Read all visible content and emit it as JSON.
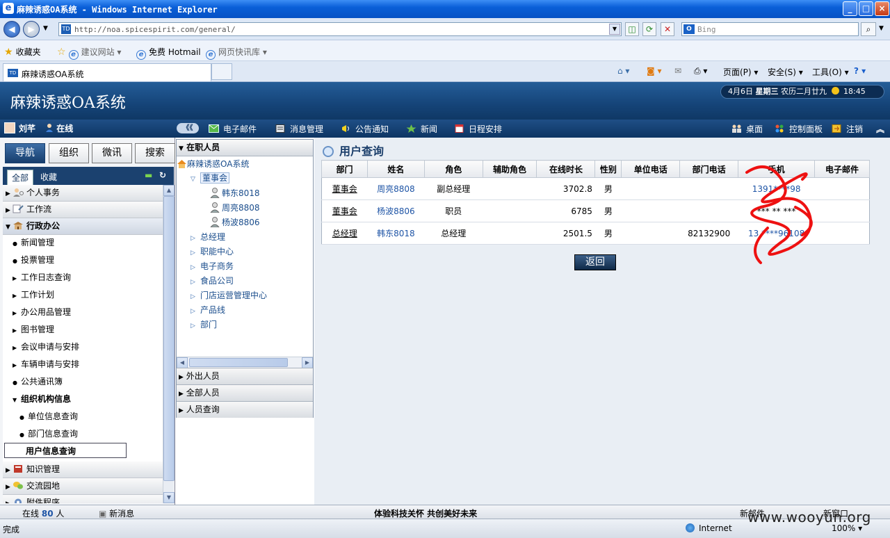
{
  "browser": {
    "window_title": "麻辣诱惑OA系统 - Windows Internet Explorer",
    "url": "http://noa.spicespirit.com/general/",
    "search_placeholder": "Bing",
    "favorites": {
      "favorites_label": "收藏夹",
      "suggested_sites": "建议网站",
      "free_hotmail": "免费 Hotmail",
      "web_slice": "网页快讯库"
    },
    "tab_title": "麻辣诱惑OA系统",
    "commands": {
      "page": "页面(P)",
      "safety": "安全(S)",
      "tools": "工具(O)"
    },
    "status_text": "完成",
    "zone": "Internet",
    "zoom": "100%"
  },
  "app": {
    "title": "麻辣诱惑OA系统",
    "date": "4月6日",
    "weekday": "星期三",
    "lunar": "农历二月廿九",
    "time": "18:45",
    "user": {
      "name": "刘芊",
      "status": "在线"
    },
    "top_nav": [
      "电子邮件",
      "消息管理",
      "公告通知",
      "新闻",
      "日程安排"
    ],
    "right_nav": {
      "desktop": "桌面",
      "control_panel": "控制面板",
      "logout": "注销"
    },
    "collapse_glyph": "《《"
  },
  "left_panel": {
    "tabs": [
      "导航",
      "组织",
      "微讯",
      "搜索"
    ],
    "subtabs": [
      "全部",
      "收藏"
    ],
    "menu": {
      "personal": "个人事务",
      "workflow": "工作流",
      "admin": "行政办公",
      "admin_items": [
        "新闻管理",
        "投票管理",
        "工作日志查询",
        "工作计划",
        "办公用品管理",
        "图书管理",
        "会议申请与安排",
        "车辆申请与安排",
        "公共通讯簿"
      ],
      "org_info": "组织机构信息",
      "org_items": [
        "单位信息查询",
        "部门信息查询"
      ],
      "selected_item": "用户信息查询",
      "knowledge": "知识管理",
      "exchange": "交流园地",
      "attach": "附件程序"
    }
  },
  "tree": {
    "header": "在职人员",
    "root": "麻辣诱惑OA系统",
    "nodes": {
      "board": "董事会",
      "board_members": [
        "韩东8018",
        "周亮8808",
        "杨波8806"
      ],
      "departments": [
        "总经理",
        "职能中心",
        "电子商务",
        "食品公司",
        "门店运营管理中心",
        "产品线",
        "部门"
      ]
    },
    "sections": [
      "外出人员",
      "全部人员",
      "人员查询"
    ]
  },
  "main": {
    "title": "用户查询",
    "columns": [
      "部门",
      "姓名",
      "角色",
      "辅助角色",
      "在线时长",
      "性别",
      "单位电话",
      "部门电话",
      "手机",
      "电子邮件"
    ],
    "rows": [
      {
        "dept": "董事会",
        "name": "周亮8808",
        "role": "副总经理",
        "aux": "",
        "online": "3702.8",
        "gender": "男",
        "unit_phone": "",
        "dept_phone": "",
        "mobile": "1391****98",
        "email": ""
      },
      {
        "dept": "董事会",
        "name": "杨波8806",
        "role": "职员",
        "aux": "",
        "online": "6785",
        "gender": "男",
        "unit_phone": "",
        "dept_phone": "",
        "mobile": "*** ** ***",
        "email": ""
      },
      {
        "dept": "总经理",
        "name": "韩东8018",
        "role": "总经理",
        "aux": "",
        "online": "2501.5",
        "gender": "男",
        "unit_phone": "",
        "dept_phone": "82132900",
        "mobile": "13 ****96108",
        "email": ""
      }
    ],
    "back_button": "返回"
  },
  "status_bar": {
    "online_prefix": "在线",
    "online_count": "80",
    "online_suffix": "人",
    "new_message": "新消息",
    "slogan": "体验科技关怀  共创美好未来",
    "new_mail": "新邮件",
    "new_window": "新窗口"
  },
  "watermark": "www.wooyun.org",
  "colors": {
    "app_header": "#154478",
    "nav_bar": "#0d3563",
    "link_blue": "#1f55a6",
    "scribble": "#ee1111"
  }
}
